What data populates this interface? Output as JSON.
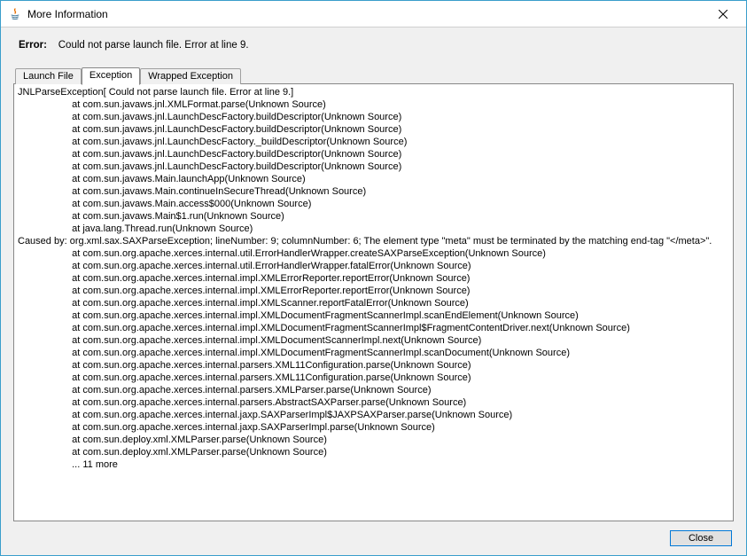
{
  "window": {
    "title": "More Information"
  },
  "error": {
    "label": "Error:",
    "message": "Could not parse launch file. Error at line 9."
  },
  "tabs": {
    "launch_file": "Launch File",
    "exception": "Exception",
    "wrapped_exception": "Wrapped Exception"
  },
  "stacktrace": "JNLParseException[ Could not parse launch file. Error at line 9.]\n                    at com.sun.javaws.jnl.XMLFormat.parse(Unknown Source)\n                    at com.sun.javaws.jnl.LaunchDescFactory.buildDescriptor(Unknown Source)\n                    at com.sun.javaws.jnl.LaunchDescFactory.buildDescriptor(Unknown Source)\n                    at com.sun.javaws.jnl.LaunchDescFactory._buildDescriptor(Unknown Source)\n                    at com.sun.javaws.jnl.LaunchDescFactory.buildDescriptor(Unknown Source)\n                    at com.sun.javaws.jnl.LaunchDescFactory.buildDescriptor(Unknown Source)\n                    at com.sun.javaws.Main.launchApp(Unknown Source)\n                    at com.sun.javaws.Main.continueInSecureThread(Unknown Source)\n                    at com.sun.javaws.Main.access$000(Unknown Source)\n                    at com.sun.javaws.Main$1.run(Unknown Source)\n                    at java.lang.Thread.run(Unknown Source)\nCaused by: org.xml.sax.SAXParseException; lineNumber: 9; columnNumber: 6; The element type \"meta\" must be terminated by the matching end-tag \"</meta>\".\n                    at com.sun.org.apache.xerces.internal.util.ErrorHandlerWrapper.createSAXParseException(Unknown Source)\n                    at com.sun.org.apache.xerces.internal.util.ErrorHandlerWrapper.fatalError(Unknown Source)\n                    at com.sun.org.apache.xerces.internal.impl.XMLErrorReporter.reportError(Unknown Source)\n                    at com.sun.org.apache.xerces.internal.impl.XMLErrorReporter.reportError(Unknown Source)\n                    at com.sun.org.apache.xerces.internal.impl.XMLScanner.reportFatalError(Unknown Source)\n                    at com.sun.org.apache.xerces.internal.impl.XMLDocumentFragmentScannerImpl.scanEndElement(Unknown Source)\n                    at com.sun.org.apache.xerces.internal.impl.XMLDocumentFragmentScannerImpl$FragmentContentDriver.next(Unknown Source)\n                    at com.sun.org.apache.xerces.internal.impl.XMLDocumentScannerImpl.next(Unknown Source)\n                    at com.sun.org.apache.xerces.internal.impl.XMLDocumentFragmentScannerImpl.scanDocument(Unknown Source)\n                    at com.sun.org.apache.xerces.internal.parsers.XML11Configuration.parse(Unknown Source)\n                    at com.sun.org.apache.xerces.internal.parsers.XML11Configuration.parse(Unknown Source)\n                    at com.sun.org.apache.xerces.internal.parsers.XMLParser.parse(Unknown Source)\n                    at com.sun.org.apache.xerces.internal.parsers.AbstractSAXParser.parse(Unknown Source)\n                    at com.sun.org.apache.xerces.internal.jaxp.SAXParserImpl$JAXPSAXParser.parse(Unknown Source)\n                    at com.sun.org.apache.xerces.internal.jaxp.SAXParserImpl.parse(Unknown Source)\n                    at com.sun.deploy.xml.XMLParser.parse(Unknown Source)\n                    at com.sun.deploy.xml.XMLParser.parse(Unknown Source)\n                    ... 11 more",
  "buttons": {
    "close": "Close"
  }
}
